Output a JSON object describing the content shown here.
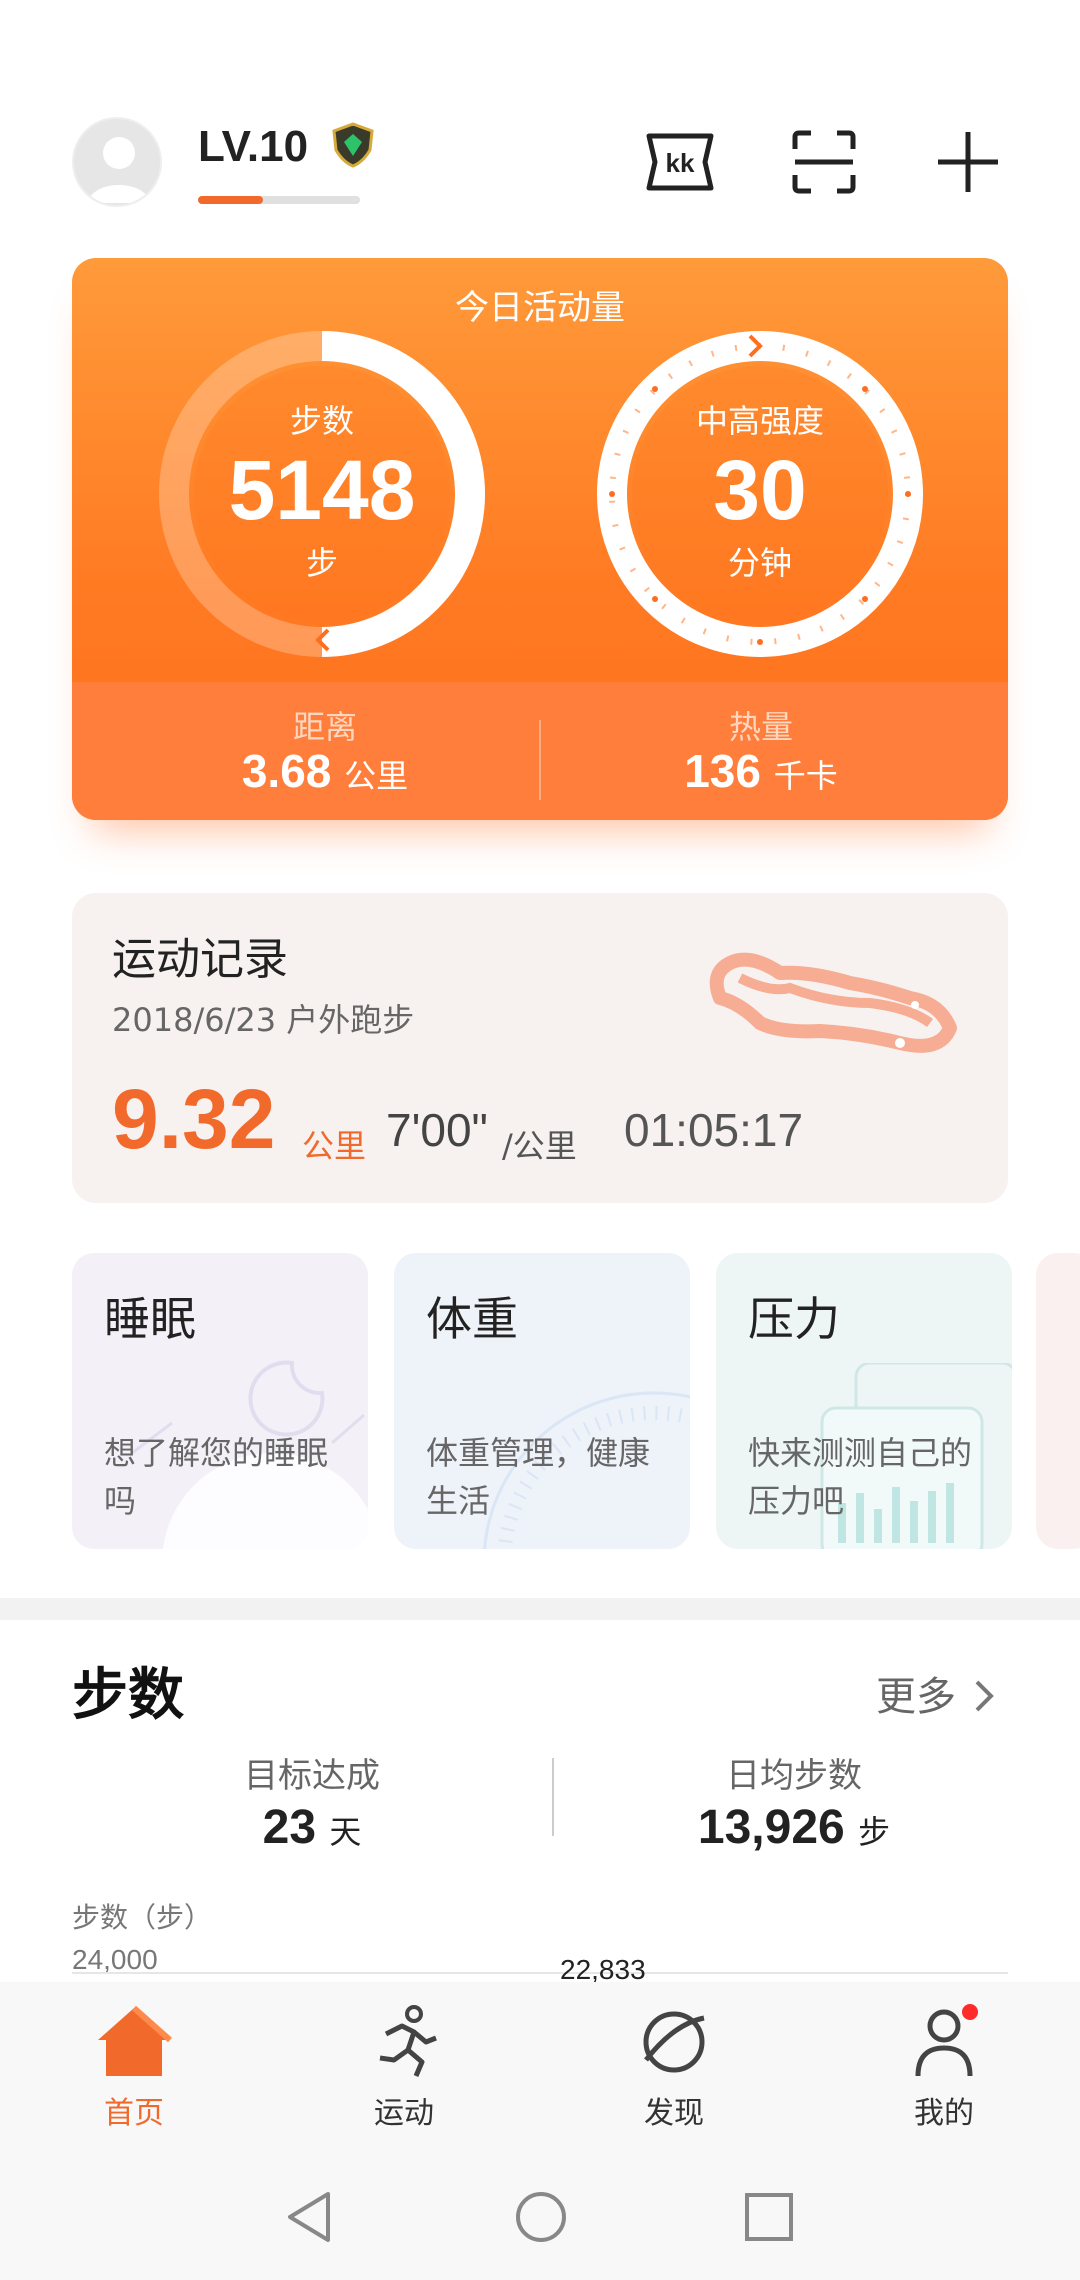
{
  "header": {
    "level": "LV.10",
    "level_progress": 0.4
  },
  "activity": {
    "title": "今日活动量",
    "steps_label": "步数",
    "steps_value": "5148",
    "steps_unit": "步",
    "intensity_label": "中高强度",
    "intensity_value": "30",
    "intensity_unit": "分钟",
    "distance_label": "距离",
    "distance_value": "3.68",
    "distance_unit": "公里",
    "calories_label": "热量",
    "calories_value": "136",
    "calories_unit": "千卡"
  },
  "record": {
    "title": "运动记录",
    "date": "2018/6/23",
    "type": "户外跑步",
    "distance": "9.32",
    "distance_unit": "公里",
    "pace": "7'00\"",
    "pace_unit": "/公里",
    "duration": "01:05:17"
  },
  "tiles": [
    {
      "title": "睡眠",
      "desc": "想了解您的睡眠吗"
    },
    {
      "title": "体重",
      "desc": "体重管理，健康生活"
    },
    {
      "title": "压力",
      "desc": "快来测测自己的压力吧"
    }
  ],
  "steps_section": {
    "title": "步数",
    "more": "更多",
    "goal_label": "目标达成",
    "goal_value": "23",
    "goal_unit": "天",
    "avg_label": "日均步数",
    "avg_value": "13,926",
    "avg_unit": "步",
    "chart_ylabel": "步数（步）",
    "chart_ymax": "24,000",
    "chart_peak": "22,833"
  },
  "nav": [
    {
      "label": "首页",
      "icon": "home-icon",
      "active": true
    },
    {
      "label": "运动",
      "icon": "running-icon",
      "active": false
    },
    {
      "label": "发现",
      "icon": "planet-icon",
      "active": false
    },
    {
      "label": "我的",
      "icon": "profile-icon",
      "active": false
    }
  ],
  "colors": {
    "accent": "#f26a2b",
    "card_orange": "#ff8a2e"
  }
}
